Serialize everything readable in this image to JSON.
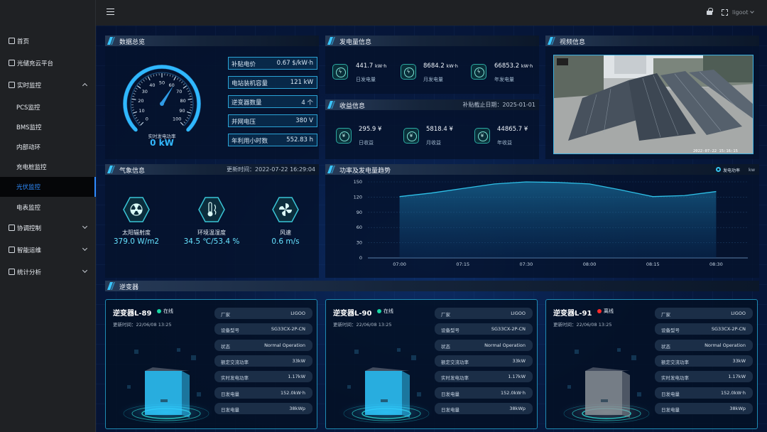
{
  "sidebar": {
    "items": [
      {
        "label": "首页",
        "icon": "door-exit-icon"
      },
      {
        "label": "光储充云平台",
        "icon": "square-arrow-icon"
      },
      {
        "label": "实时监控",
        "icon": "monitor-icon",
        "expanded": true
      },
      {
        "label": "PCS监控"
      },
      {
        "label": "BMS监控"
      },
      {
        "label": "内部动环"
      },
      {
        "label": "充电桩监控"
      },
      {
        "label": "光伏监控",
        "active": true
      },
      {
        "label": "电表监控"
      },
      {
        "label": "协调控制",
        "icon": "image-icon"
      },
      {
        "label": "智能运维",
        "icon": "monitor-icon"
      },
      {
        "label": "统计分析",
        "icon": "square-arrow-icon"
      }
    ]
  },
  "topbar": {
    "user": "ligoot"
  },
  "overview": {
    "title": "数据总览",
    "gauge": {
      "label": "实时发电功率",
      "value": "0 kW",
      "ticks": [
        "0",
        "10",
        "20",
        "30",
        "40",
        "50",
        "60",
        "70",
        "80",
        "90",
        "100"
      ],
      "level": 0.62
    },
    "rows": [
      {
        "label": "补贴电价",
        "value": "0.67 $/kW·h"
      },
      {
        "label": "电站装机容量",
        "value": "121 kW"
      },
      {
        "label": "逆变器数量",
        "value": "4 个"
      },
      {
        "label": "并网电压",
        "value": "380 V"
      },
      {
        "label": "年利用小时数",
        "value": "552.83 h"
      }
    ]
  },
  "generation": {
    "title": "发电量信息",
    "items": [
      {
        "value": "441.7",
        "unit": "kW·h",
        "label": "日发电量"
      },
      {
        "value": "8684.2",
        "unit": "kW·h",
        "label": "月发电量"
      },
      {
        "value": "66853.2",
        "unit": "kW·h",
        "label": "年发电量"
      }
    ]
  },
  "income": {
    "title": "收益信息",
    "note": "补贴截止日期：2025-01-01",
    "items": [
      {
        "value": "295.9",
        "unit": "¥",
        "label": "日收益"
      },
      {
        "value": "5818.4",
        "unit": "¥",
        "label": "月收益"
      },
      {
        "value": "44865.7",
        "unit": "¥",
        "label": "年收益"
      }
    ]
  },
  "video": {
    "title": "视频信息",
    "timestamp": "2022-07-22 15:16:15"
  },
  "weather": {
    "title": "气象信息",
    "updated": "更新时间：2022-07-22 16:29:04",
    "items": [
      {
        "label": "太阳辐射度",
        "value": "379.0 W/m2",
        "icon": "radiation-icon"
      },
      {
        "label": "环境温湿度",
        "value": "34.5 ℃/53.4 %",
        "icon": "thermometer-icon"
      },
      {
        "label": "风速",
        "value": "0.6 m/s",
        "icon": "fan-icon"
      }
    ]
  },
  "trend": {
    "title": "功率及发电量趋势",
    "legend": "发电功率",
    "unit": "kw"
  },
  "chart_data": {
    "type": "area",
    "x": [
      "07:00",
      "07:15",
      "07:30",
      "08:00",
      "08:15",
      "08:30"
    ],
    "x_ticks": [
      "07:00",
      "07:15",
      "07:30",
      "08:00",
      "08:15",
      "08:30"
    ],
    "series": [
      {
        "name": "发电功率",
        "points": [
          [
            0,
            121
          ],
          [
            0.5,
            128
          ],
          [
            1,
            137
          ],
          [
            1.5,
            146
          ],
          [
            2,
            150
          ],
          [
            2.5,
            149
          ],
          [
            3,
            146
          ],
          [
            3.5,
            134
          ],
          [
            4,
            121
          ],
          [
            4.5,
            123
          ],
          [
            5,
            131
          ]
        ]
      }
    ],
    "ylim": [
      0,
      150
    ],
    "yticks": [
      0,
      30,
      60,
      90,
      120,
      150
    ],
    "color": "#2ec1e8"
  },
  "inverters": {
    "title": "逆变器",
    "spec_keys": [
      "厂家",
      "设备型号",
      "状态",
      "额定交流功率",
      "实时发电功率",
      "日发电量",
      "日发电量"
    ],
    "cards": [
      {
        "name": "逆变器L-89",
        "status": "在线",
        "status_color": "#18d6a2",
        "time": "更新时间：22/06/08 13:25",
        "specs": [
          "LIGOO",
          "SG33CX-2P-CN",
          "Normal Operation",
          "33kW",
          "1.17kW",
          "152.0kW·h",
          "38kWp"
        ],
        "device_color": "#2fc9ff"
      },
      {
        "name": "逆变器L-90",
        "status": "在线",
        "status_color": "#18d6a2",
        "time": "更新时间：22/06/08 13:25",
        "specs": [
          "LIGOO",
          "SG33CX-2P-CN",
          "Normal Operation",
          "33kW",
          "1.17kW",
          "152.0kW·h",
          "38kWp"
        ],
        "device_color": "#2fc9ff"
      },
      {
        "name": "逆变器L-91",
        "status": "离线",
        "status_color": "#ff2a2a",
        "time": "更新时间：22/06/08 13:25",
        "specs": [
          "LIGOO",
          "SG33CX-2P-CN",
          "Normal Operation",
          "33kW",
          "1.17kW",
          "152.0kW·h",
          "38kWp"
        ],
        "device_color": "#8a9096"
      }
    ]
  }
}
